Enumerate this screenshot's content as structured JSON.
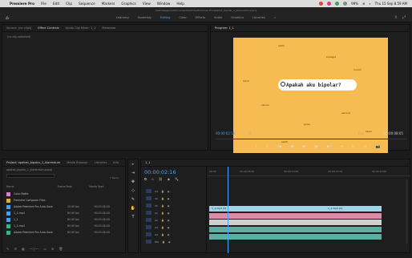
{
  "menubar": {
    "apple": "",
    "app": "Premiere Pro",
    "items": [
      "File",
      "Edit",
      "Clip",
      "Sequence",
      "Markers",
      "Graphics",
      "View",
      "Window",
      "Help"
    ],
    "clock": "Thu 15 Sep 8.59 AM",
    "battery": "99%"
  },
  "titlebar": {
    "path": "/Users/tegarnet/Documents/Adobe/Premiere Pro/apakah_bipolar_1_klarendum.prproj"
  },
  "workspaces": {
    "home": "⌂",
    "tabs": [
      "Learning",
      "Assembly",
      "Editing",
      "Color",
      "Effects",
      "Audio",
      "Graphics",
      "Libraries",
      "»"
    ],
    "active_index": 2
  },
  "source": {
    "tabs": [
      "Source: (no clips)",
      "Effect Controls",
      "Audio Clip Mixer: 1_1",
      "Metadata"
    ],
    "empty_text": "(no clip selected)"
  },
  "program": {
    "tab": "Program: 1_1",
    "bubble_text": "Apakah aku bipolar?",
    "words": [
      "sedih",
      "bahagia",
      "marah",
      "takut",
      "cemas",
      "senang",
      "galau",
      "kesal",
      "sedih"
    ],
    "timecode": "00:00:02:16",
    "fit": "Fit",
    "quality": "Full",
    "duration": "00:00:08:05",
    "transport": [
      "{",
      "}",
      "|◀",
      "◀|",
      "▶",
      "|▶",
      "▶|",
      "⇥",
      "⇤",
      "⊡",
      "📷"
    ]
  },
  "project": {
    "tabs": [
      "Project: apakah_bipolar_1_klarendum",
      "Media Browser",
      "Libraries",
      "Info"
    ],
    "path": "apakah_bipolar_1_klarendum.prproj",
    "search_placeholder": "",
    "count": "7 Items",
    "columns": [
      "Name",
      "Frame Rate",
      "Media Start"
    ],
    "rows": [
      {
        "name": "Color Matte",
        "fps": "",
        "start": "",
        "color": "#d880d0"
      },
      {
        "name": "Premiere Composer Files",
        "fps": "",
        "start": "",
        "color": "#d8b040"
      },
      {
        "name": "Adobe Premiere Pro Auto-Save",
        "fps": "25.00 fps",
        "start": "00:00:00:00",
        "color": "#4f9be8"
      },
      {
        "name": "1_1.mp4",
        "fps": "60.00 fps",
        "start": "00:00:00:00",
        "color": "#4f9be8"
      },
      {
        "name": "1_1",
        "fps": "60.00 fps",
        "start": "00:00:00:00",
        "color": "#4f9be8"
      },
      {
        "name": "1_1.mp4",
        "fps": "60.00 fps",
        "start": "00:00:00:00",
        "color": "#40b080"
      },
      {
        "name": "Adobe Premiere Pro Auto-Save",
        "fps": "60.00 fps",
        "start": "00:00:00:00",
        "color": "#40b080"
      }
    ]
  },
  "tools": [
    "▸",
    "⇥",
    "✥",
    "◇",
    "✎",
    "✋",
    "T"
  ],
  "timeline": {
    "tab": "1_1",
    "timecode": "00:00:02:16",
    "ruler": [
      "00:00",
      "00:00:05:00",
      "00:00:10:00",
      "00:00:15:00",
      "00:00:20:00"
    ],
    "tracks": [
      "V3",
      "V2",
      "V1",
      "A1",
      "A2",
      "A3",
      "A4",
      "Mix"
    ],
    "clips": {
      "video_a": "1_1.mp4 [V]",
      "video_b": "1_1.mp4 [V]"
    }
  },
  "colors": {
    "accent": "#4aa3ff",
    "frame_bg": "#f6bc52",
    "video_clip": "#9fd3e8",
    "audio_clip": "#5ab0a0",
    "pink_clip": "#e08aa8"
  }
}
